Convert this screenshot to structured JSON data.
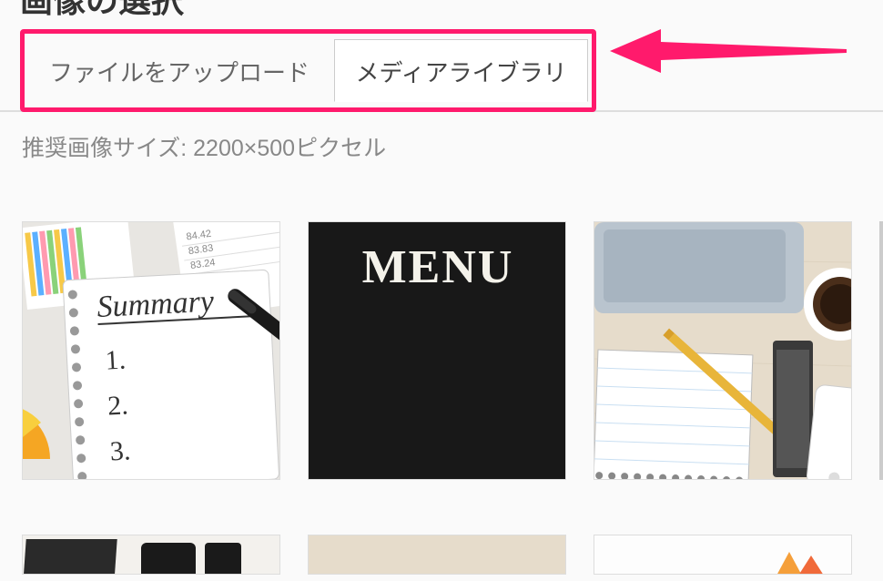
{
  "header": {
    "title": "画像の選択",
    "tabs": {
      "upload_label": "ファイルをアップロード",
      "library_label": "メディアライブラリ"
    },
    "hint": "推奨画像サイズ: 2200×500ピクセル"
  },
  "media": {
    "items": [
      {
        "name": "summary-notebook"
      },
      {
        "name": "menu-chalkboard"
      },
      {
        "name": "desk-laptop-notebook"
      },
      {
        "name": "partial-right"
      },
      {
        "name": "row2-item-1"
      },
      {
        "name": "row2-item-2"
      },
      {
        "name": "row2-item-3"
      }
    ]
  }
}
